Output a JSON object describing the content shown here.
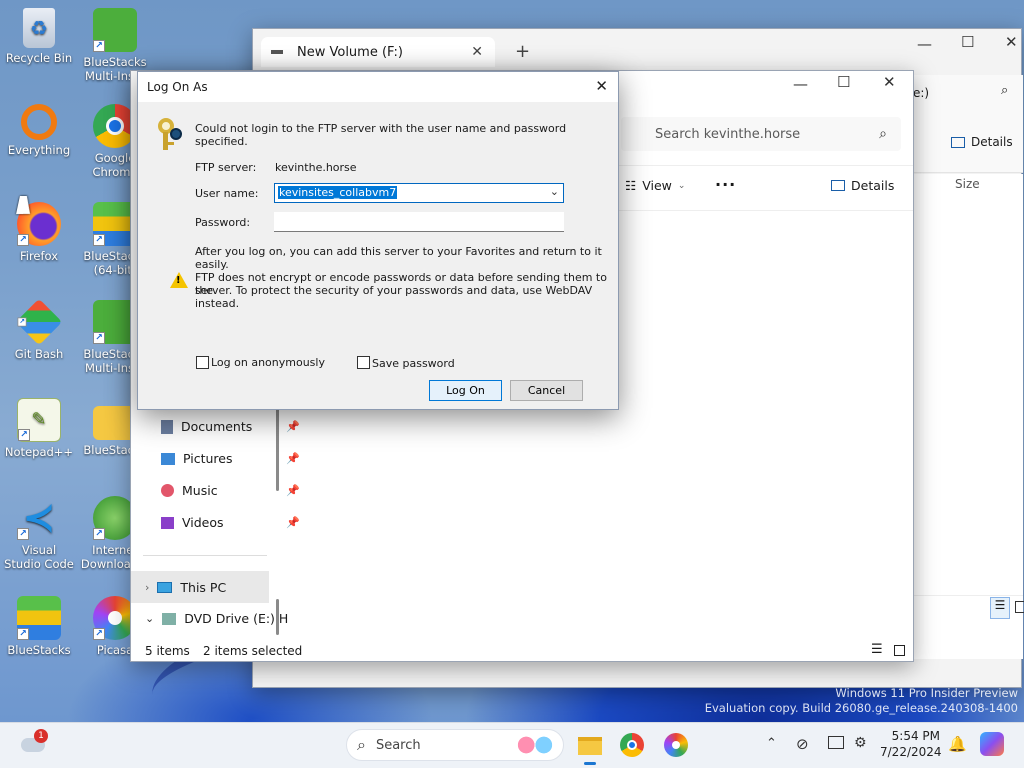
{
  "desktop": {
    "icons": [
      {
        "label": "Recycle Bin"
      },
      {
        "label": "BlueStacks Multi-Ins..."
      },
      {
        "label": "Everything"
      },
      {
        "label": "Google Chrome"
      },
      {
        "label": "Firefox"
      },
      {
        "label": "BlueStacks (64-bit)"
      },
      {
        "label": "Git Bash"
      },
      {
        "label": "BlueStacks Multi-Ins..."
      },
      {
        "label": "Notepad++"
      },
      {
        "label": "BlueStacks"
      },
      {
        "label": "Visual Studio Code"
      },
      {
        "label": "Internet Download..."
      },
      {
        "label": "BlueStacks"
      },
      {
        "label": "Picasa"
      }
    ]
  },
  "back_window": {
    "tab_title": "New Volume (F:)",
    "column": "Size",
    "details_label": "Details",
    "partial_text": "e:)"
  },
  "explorer": {
    "search_placeholder": "Search kevinthe.horse",
    "view_label": "View",
    "details_label": "Details",
    "nav": [
      {
        "label": "Documents"
      },
      {
        "label": "Pictures"
      },
      {
        "label": "Music"
      },
      {
        "label": "Videos"
      },
      {
        "label": "This PC"
      },
      {
        "label": "DVD Drive (E:) H"
      }
    ],
    "status_items": "5 items",
    "status_selected": "2 items selected"
  },
  "dialog": {
    "title": "Log On As",
    "message": "Could not login to the FTP server with the user name and password specified.",
    "ftp_server_label": "FTP server:",
    "ftp_server_value": "kevinthe.horse",
    "user_name_label": "User name:",
    "user_name_value": "kevinsites_collabvm7",
    "password_label": "Password:",
    "password_value": "",
    "favorites_note": "After you log on, you can add this server to your Favorites and return to it easily.",
    "warning_line1": "FTP does not encrypt or encode passwords or data before sending them to the",
    "warning_line2": "server.  To protect the security of your passwords and data, use WebDAV instead.",
    "anonymous_label": "Log on anonymously",
    "save_password_label": "Save password",
    "logon_button": "Log On",
    "cancel_button": "Cancel"
  },
  "watermark": {
    "line1": "Windows 11 Pro Insider Preview",
    "line2": "Evaluation copy. Build 26080.ge_release.240308-1400"
  },
  "taskbar": {
    "search_label": "Search",
    "weather_badge": "1",
    "time": "5:54 PM",
    "date": "7/22/2024"
  }
}
